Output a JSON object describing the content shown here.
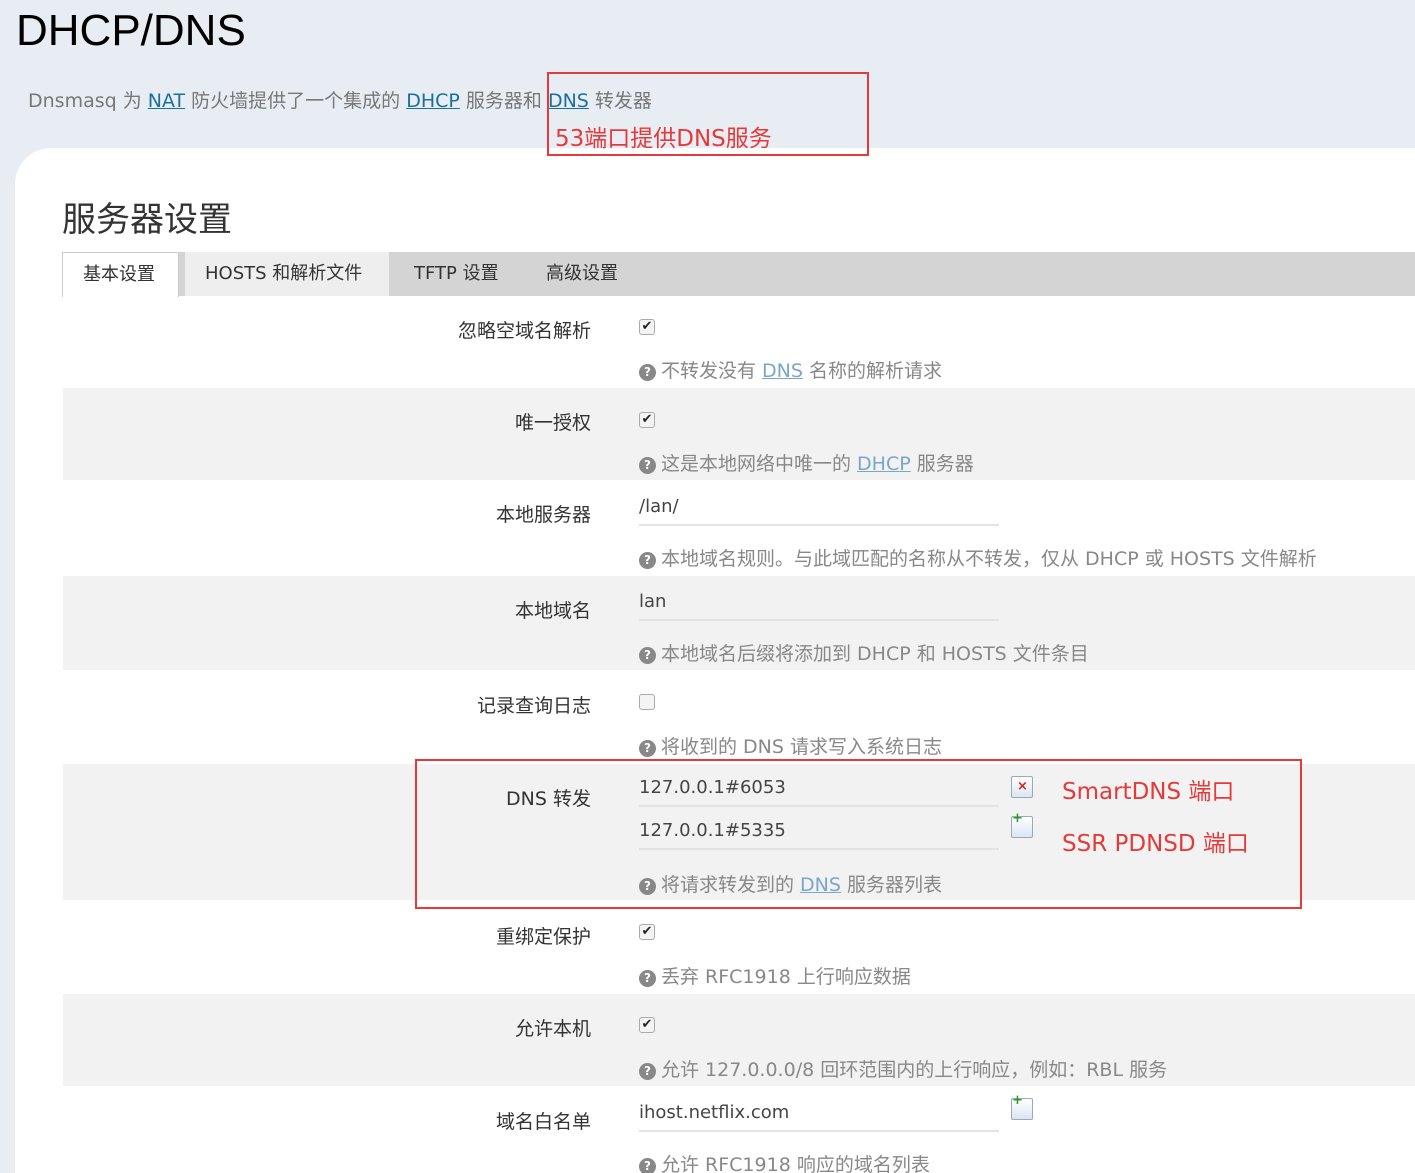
{
  "page": {
    "title": "DHCP/DNS",
    "desc_prefix": "Dnsmasq 为 ",
    "desc_link1": "NAT",
    "desc_mid1": " 防火墙提供了一个集成的 ",
    "desc_link2": "DHCP",
    "desc_mid2": " 服务器和 ",
    "desc_link3": "DNS",
    "desc_suffix": " 转发器"
  },
  "annotations": {
    "port53": "53端口提供DNS服务",
    "smartdns": "SmartDNS 端口",
    "ssr": "SSR PDNSD 端口"
  },
  "section": {
    "title": "服务器设置"
  },
  "tabs": [
    "基本设置",
    "HOSTS 和解析文件",
    "TFTP 设置",
    "高级设置"
  ],
  "fields": {
    "domainneeded": {
      "label": "忽略空域名解析",
      "checked": true,
      "help_pre": "不转发没有 ",
      "help_link": "DNS",
      "help_post": " 名称的解析请求"
    },
    "authoritative": {
      "label": "唯一授权",
      "checked": true,
      "help_pre": "这是本地网络中唯一的 ",
      "help_link": "DHCP",
      "help_post": " 服务器"
    },
    "local": {
      "label": "本地服务器",
      "value": "/lan/",
      "help": "本地域名规则。与此域匹配的名称从不转发，仅从 DHCP 或 HOSTS 文件解析"
    },
    "domain": {
      "label": "本地域名",
      "value": "lan",
      "help": "本地域名后缀将添加到 DHCP 和 HOSTS 文件条目"
    },
    "logqueries": {
      "label": "记录查询日志",
      "checked": false,
      "help": "将收到的 DNS 请求写入系统日志"
    },
    "server": {
      "label": "DNS 转发",
      "values": [
        "127.0.0.1#6053",
        "127.0.0.1#5335"
      ],
      "help_pre": "将请求转发到的 ",
      "help_link": "DNS",
      "help_post": " 服务器列表"
    },
    "rebind_protection": {
      "label": "重绑定保护",
      "checked": true,
      "help": "丢弃 RFC1918 上行响应数据"
    },
    "rebind_localhost": {
      "label": "允许本机",
      "checked": true,
      "help": "允许 127.0.0.0/8 回环范围内的上行响应，例如：RBL 服务"
    },
    "rebind_domain": {
      "label": "域名白名单",
      "value": "ihost.netflix.com",
      "help": "允许 RFC1918 响应的域名列表"
    }
  },
  "icons": {
    "help": "?",
    "check": "✔",
    "add": "+",
    "remove": "×"
  }
}
